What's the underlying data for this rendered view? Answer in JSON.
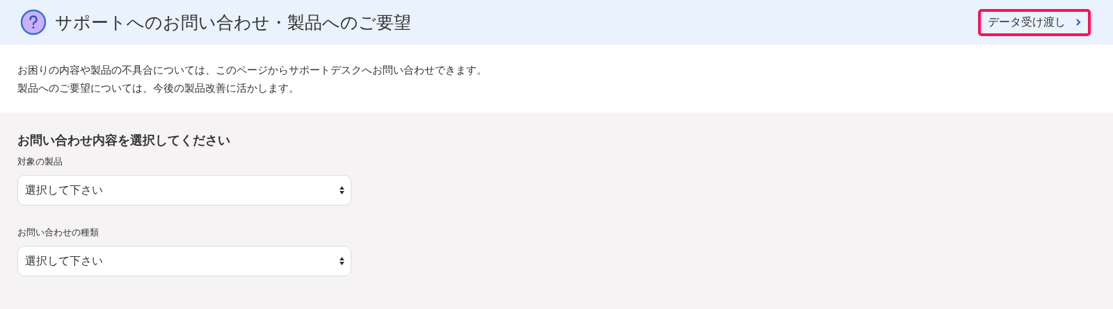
{
  "header": {
    "title": "サポートへのお問い合わせ・製品へのご要望",
    "button": "データ受け渡し"
  },
  "intro": [
    "お困りの内容や製品の不具合については、このページからサポートデスクへお問い合わせできます。",
    "製品へのご要望については、今後の製品改善に活かします。"
  ],
  "form": {
    "heading": "お問い合わせ内容を選択してください",
    "fields": [
      {
        "label": "対象の製品",
        "value": "選択して下さい"
      },
      {
        "label": "お問い合わせの種類",
        "value": "選択して下さい"
      }
    ]
  }
}
